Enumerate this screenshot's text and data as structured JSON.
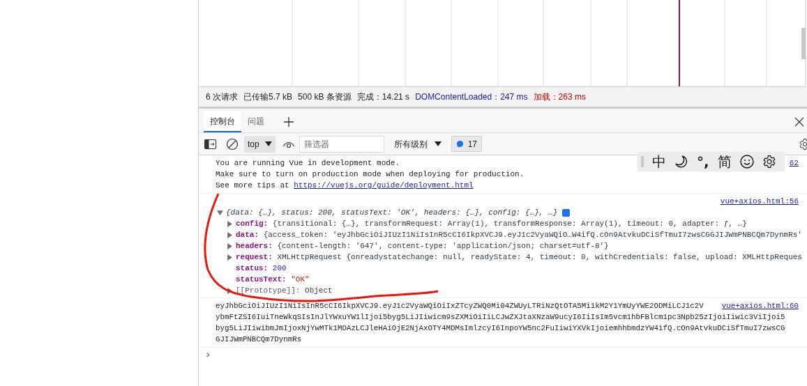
{
  "status_bar": [
    {
      "text": "6 次请求",
      "kind": "plain"
    },
    {
      "text": "已传输5.7 kB",
      "kind": "plain"
    },
    {
      "text": "500 kB 条资源",
      "kind": "plain"
    },
    {
      "text": "完成：14.21 s",
      "kind": "plain"
    },
    {
      "text": "DOMContentLoaded：247 ms",
      "kind": "dom"
    },
    {
      "text": "加载：263 ms",
      "kind": "load"
    }
  ],
  "tabs": [
    {
      "label": "控制台",
      "selected": true
    },
    {
      "label": "问题",
      "selected": false
    }
  ],
  "toolbar": {
    "context": "top",
    "filter": {
      "placeholder": "筛选器"
    },
    "levels": "所有级别",
    "message_count": "17"
  },
  "ime_toolbar": {
    "chinese": "中",
    "punct": "°,",
    "simplified": "简"
  },
  "messages": [
    {
      "kind": "text",
      "source": "62",
      "lines": [
        "You are running Vue in development mode.",
        "Make sure to turn on production mode when deploying for production."
      ],
      "tip": {
        "text": "See more tips at ",
        "link": "https://vuejs.org/guide/deployment.html"
      }
    },
    {
      "kind": "object",
      "source": "vue+axios.html:56",
      "summary": "{data: {…}, status: 200, statusText: 'OK', headers: {…}, config: {…}, …}",
      "expanded": true,
      "properties": [
        {
          "key": "config:",
          "value": "{transitional: {…}, transformRequest: Array(1), transformResponse: Array(1), timeout: 0, adapter: ƒ, …}",
          "expandable": true,
          "kind": "object"
        },
        {
          "key": "data:",
          "value": "{access_token: 'eyJhbGciOiJIUzI1NiIsInR5cCI6IkpXVCJ9.eyJ1c2VyaWQiO…W4ifQ.cOn9AtvkuDCiSfTmuI7zwsCGGJIJWmPNBCQm7DynmRs'",
          "expandable": true,
          "kind": "object"
        },
        {
          "key": "headers:",
          "value": "{content-length: '647', content-type: 'application/json; charset=utf-8'}",
          "expandable": true,
          "kind": "object"
        },
        {
          "key": "request:",
          "value": "XMLHttpRequest {onreadystatechange: null, readyState: 4, timeout: 0, withCredentials: false, upload: XMLHttpReques",
          "expandable": true,
          "kind": "object"
        },
        {
          "key": "status:",
          "value": "200",
          "expandable": false,
          "kind": "number"
        },
        {
          "key": "statusText:",
          "value": "\"OK\"",
          "expandable": false,
          "kind": "string"
        },
        {
          "key": "[[Prototype]]:",
          "value": "Object",
          "expandable": true,
          "kind": "internal"
        }
      ]
    },
    {
      "kind": "token",
      "source": "vue+axios.html:60",
      "lines": [
        "eyJhbGciOiJIUzI1NiIsInR5cCI6IkpXVCJ9.eyJ1c2VyaWQiOiIxZTcyZWQ0Mi04ZWUyLTRiNzQtOTA5Mi1kM2Y1YmUyYWE2ODMiLCJ1c2V",
        "ybmFtZSI6IuiTneWkqSIsInJlYWxuYW1lIjoi5byg5LiJIiwicm9sZXMiOiIiLCJwZXJtaXNzaW9ucyI6IiIsIm5vcm1hbFBlcm1pc3Npb25zIjoiIiwic3ViIjoi5",
        "byg5LiJIiwibmJmIjoxNjYwMTk1MDAzLCJleHAiOjE2NjAxOTY4MDMsImlzcyI6InpoYW5nc2FuIiwiYXVkIjoiemhhbmdzYW4ifQ.cOn9AtvkuDCiSfTmuI7zwsCG",
        "GJIJWmPNBCQm7DynmRs"
      ]
    }
  ],
  "prompt": "›"
}
